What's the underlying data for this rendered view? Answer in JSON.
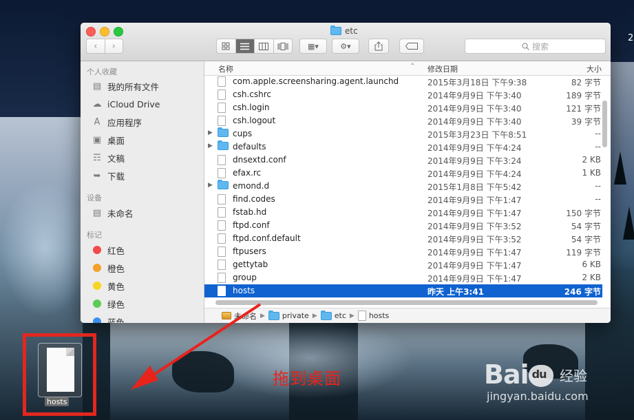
{
  "window": {
    "title": "etc",
    "search_placeholder": "搜索"
  },
  "sidebar": {
    "sections": [
      {
        "header": "个人收藏",
        "items": [
          {
            "label": "我的所有文件",
            "icon": "all-files-icon"
          },
          {
            "label": "iCloud Drive",
            "icon": "cloud-icon"
          },
          {
            "label": "应用程序",
            "icon": "applications-icon"
          },
          {
            "label": "桌面",
            "icon": "desktop-icon"
          },
          {
            "label": "文稿",
            "icon": "documents-icon"
          },
          {
            "label": "下载",
            "icon": "downloads-icon"
          }
        ]
      },
      {
        "header": "设备",
        "items": [
          {
            "label": "未命名",
            "icon": "disk-icon"
          }
        ]
      },
      {
        "header": "标记",
        "items": [
          {
            "label": "红色",
            "color": "#f34a4a"
          },
          {
            "label": "橙色",
            "color": "#f5a12b"
          },
          {
            "label": "黄色",
            "color": "#f7d51f"
          },
          {
            "label": "绿色",
            "color": "#5ccb55"
          },
          {
            "label": "蓝色",
            "color": "#3d8fef"
          }
        ]
      }
    ]
  },
  "columns": {
    "name": "名称",
    "date": "修改日期",
    "size": "大小"
  },
  "files": [
    {
      "name": "com.apple.screensharing.agent.launchd",
      "date": "2015年3月18日 下午9:38",
      "size": "82 字节",
      "type": "file"
    },
    {
      "name": "csh.cshrc",
      "date": "2014年9月9日 下午3:40",
      "size": "189 字节",
      "type": "file"
    },
    {
      "name": "csh.login",
      "date": "2014年9月9日 下午3:40",
      "size": "121 字节",
      "type": "file"
    },
    {
      "name": "csh.logout",
      "date": "2014年9月9日 下午3:40",
      "size": "39 字节",
      "type": "file"
    },
    {
      "name": "cups",
      "date": "2015年3月23日 下午8:51",
      "size": "--",
      "type": "folder"
    },
    {
      "name": "defaults",
      "date": "2014年9月9日 下午4:24",
      "size": "--",
      "type": "folder"
    },
    {
      "name": "dnsextd.conf",
      "date": "2014年9月9日 下午3:24",
      "size": "2 KB",
      "type": "file"
    },
    {
      "name": "efax.rc",
      "date": "2014年9月9日 下午4:24",
      "size": "1 KB",
      "type": "file"
    },
    {
      "name": "emond.d",
      "date": "2015年1月8日 下午5:42",
      "size": "--",
      "type": "folder"
    },
    {
      "name": "find.codes",
      "date": "2014年9月9日 下午1:47",
      "size": "--",
      "type": "file"
    },
    {
      "name": "fstab.hd",
      "date": "2014年9月9日 下午1:47",
      "size": "150 字节",
      "type": "file"
    },
    {
      "name": "ftpd.conf",
      "date": "2014年9月9日 下午3:52",
      "size": "54 字节",
      "type": "file"
    },
    {
      "name": "ftpd.conf.default",
      "date": "2014年9月9日 下午3:52",
      "size": "54 字节",
      "type": "file"
    },
    {
      "name": "ftpusers",
      "date": "2014年9月9日 下午1:47",
      "size": "119 字节",
      "type": "file"
    },
    {
      "name": "gettytab",
      "date": "2014年9月9日 下午1:47",
      "size": "6 KB",
      "type": "file"
    },
    {
      "name": "group",
      "date": "2014年9月9日 下午1:47",
      "size": "2 KB",
      "type": "file"
    },
    {
      "name": "hosts",
      "date": "昨天 上午3:41",
      "size": "246 字节",
      "type": "file",
      "selected": true
    }
  ],
  "path": [
    "未命名",
    "private",
    "etc",
    "hosts"
  ],
  "desktop": {
    "file_label": "hosts",
    "annotation": "拖到桌面",
    "annotation_color": "#e8231c",
    "highlight_color": "#e2271f",
    "corner_digit": "2"
  },
  "watermark": {
    "logo_a": "Bai",
    "logo_b": "百度",
    "cn": "经验",
    "url": "jingyan.baidu.com"
  }
}
